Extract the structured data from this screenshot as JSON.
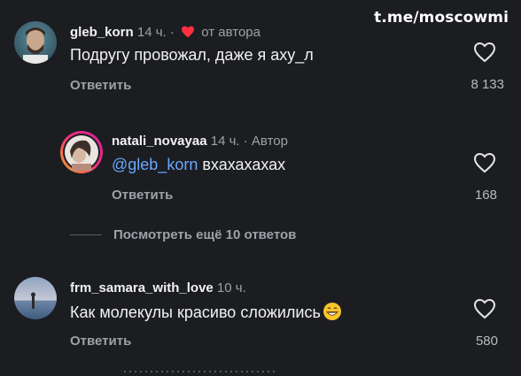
{
  "watermark": "t.me/moscowmi",
  "comments": [
    {
      "username": "gleb_korn",
      "time": "14 ч.",
      "separator": "·",
      "badge": "от автора",
      "text": "Подругу провожал, даже я аху_л",
      "reply_label": "Ответить",
      "likes": "8 133"
    },
    {
      "username": "natali_novayaa",
      "time": "14 ч.",
      "separator": "·",
      "badge": "Автор",
      "mention": "@gleb_korn",
      "text": "вхахахахах",
      "reply_label": "Ответить",
      "likes": "168"
    },
    {
      "username": "frm_samara_with_love",
      "time": "10 ч.",
      "text": "Как молекулы красиво сложились",
      "reply_label": "Ответить",
      "likes": "580"
    }
  ],
  "more_replies": "Посмотреть ещё 10 ответов",
  "colors": {
    "background": "#1b1d21",
    "mention": "#6aa8ff",
    "author_heart": "#ff3040",
    "story_ring_start": "#f9a825",
    "story_ring_end": "#d6249f"
  }
}
